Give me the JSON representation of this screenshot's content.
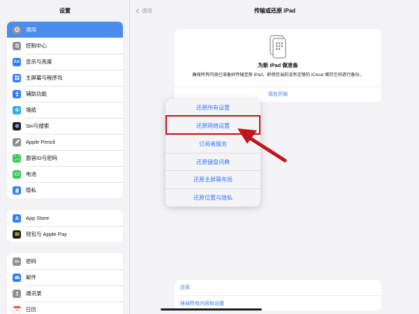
{
  "sidebar": {
    "title": "设置",
    "groups": [
      [
        {
          "label": "通用",
          "icon": "gear-icon",
          "color": "#8e8e93"
        },
        {
          "label": "控制中心",
          "icon": "control-center-icon",
          "color": "#8e8e93"
        },
        {
          "label": "显示与亮度",
          "icon": "display-icon",
          "color": "#2f7cf6"
        },
        {
          "label": "主屏幕与程序坞",
          "icon": "home-screen-icon",
          "color": "#2f7cf6"
        },
        {
          "label": "辅助功能",
          "icon": "accessibility-icon",
          "color": "#2f7cf6"
        },
        {
          "label": "墙纸",
          "icon": "wallpaper-icon",
          "color": "#34aadc"
        },
        {
          "label": "Siri与搜索",
          "icon": "siri-icon",
          "color": "#1c1c1e"
        },
        {
          "label": "Apple Pencil",
          "icon": "pencil-icon",
          "color": "#8e8e93"
        },
        {
          "label": "面容ID与密码",
          "icon": "faceid-icon",
          "color": "#34c759"
        },
        {
          "label": "电池",
          "icon": "battery-icon",
          "color": "#34c759"
        },
        {
          "label": "隐私",
          "icon": "hand-icon",
          "color": "#2f7cf6"
        }
      ],
      [
        {
          "label": "App Store",
          "icon": "app-store-icon",
          "color": "#2f7cf6"
        },
        {
          "label": "钱包与 Apple Pay",
          "icon": "wallet-icon",
          "color": "#1c1c1e"
        }
      ],
      [
        {
          "label": "密码",
          "icon": "key-icon",
          "color": "#8e8e93"
        },
        {
          "label": "邮件",
          "icon": "mail-icon",
          "color": "#2f7cf6"
        },
        {
          "label": "通讯录",
          "icon": "contacts-icon",
          "color": "#8e8e93"
        },
        {
          "label": "日历",
          "icon": "calendar-icon",
          "color": "#ff3b30"
        }
      ]
    ]
  },
  "header": {
    "back_label": "通用",
    "title": "传输或还原 iPad"
  },
  "prepare_card": {
    "heading": "为新 iPad 做准备",
    "description": "确保所有内容已准备好传输至新 iPad，即使您当前没有足够的 iCloud 储存空间进行备份。",
    "link": "现在开始"
  },
  "bottom_card": {
    "reset": "还原",
    "erase": "抹掉所有内容和设置"
  },
  "reset_menu": {
    "items": [
      "还原所有设置",
      "还原网络设置",
      "订阅者服务",
      "还原键盘词典",
      "还原主屏幕布局",
      "还原位置与隐私"
    ]
  },
  "accent_color": "#3478f6",
  "highlight_color": "#c0151b"
}
